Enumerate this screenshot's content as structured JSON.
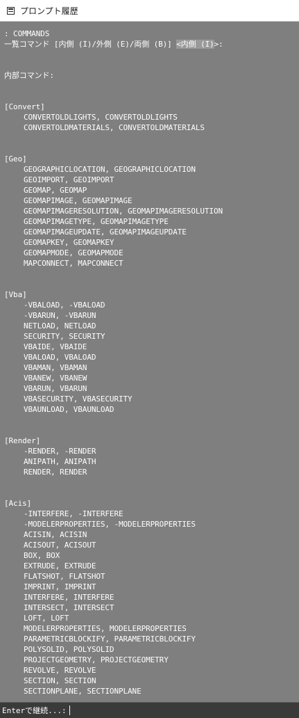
{
  "window": {
    "title": "プロンプト履歴"
  },
  "history": {
    "cmd_line": ": COMMANDS",
    "list_prompt_before": "一覧コマンド [内側 (I)/外側 (E)/両側 (B)] ",
    "list_prompt_default": "<内側 (I)",
    "list_prompt_after": ">:",
    "inner_header": "内部コマンド:",
    "groups": [
      {
        "name": "[Convert]",
        "items": [
          "CONVERTOLDLIGHTS, CONVERTOLDLIGHTS",
          "CONVERTOLDMATERIALS, CONVERTOLDMATERIALS"
        ]
      },
      {
        "name": "[Geo]",
        "items": [
          "GEOGRAPHICLOCATION, GEOGRAPHICLOCATION",
          "GEOIMPORT, GEOIMPORT",
          "GEOMAP, GEOMAP",
          "GEOMAPIMAGE, GEOMAPIMAGE",
          "GEOMAPIMAGERESOLUTION, GEOMAPIMAGERESOLUTION",
          "GEOMAPIMAGETYPE, GEOMAPIMAGETYPE",
          "GEOMAPIMAGEUPDATE, GEOMAPIMAGEUPDATE",
          "GEOMAPKEY, GEOMAPKEY",
          "GEOMAPMODE, GEOMAPMODE",
          "MAPCONNECT, MAPCONNECT"
        ]
      },
      {
        "name": "[Vba]",
        "items": [
          "-VBALOAD, -VBALOAD",
          "-VBARUN, -VBARUN",
          "NETLOAD, NETLOAD",
          "SECURITY, SECURITY",
          "VBAIDE, VBAIDE",
          "VBALOAD, VBALOAD",
          "VBAMAN, VBAMAN",
          "VBANEW, VBANEW",
          "VBARUN, VBARUN",
          "VBASECURITY, VBASECURITY",
          "VBAUNLOAD, VBAUNLOAD"
        ]
      },
      {
        "name": "[Render]",
        "items": [
          "-RENDER, -RENDER",
          "ANIPATH, ANIPATH",
          "RENDER, RENDER"
        ]
      },
      {
        "name": "[Acis]",
        "items": [
          "-INTERFERE, -INTERFERE",
          "-MODELERPROPERTIES, -MODELERPROPERTIES",
          "ACISIN, ACISIN",
          "ACISOUT, ACISOUT",
          "BOX, BOX",
          "EXTRUDE, EXTRUDE",
          "FLATSHOT, FLATSHOT",
          "IMPRINT, IMPRINT",
          "INTERFERE, INTERFERE",
          "INTERSECT, INTERSECT",
          "LOFT, LOFT",
          "MODELERPROPERTIES, MODELERPROPERTIES",
          "PARAMETRICBLOCKIFY, PARAMETRICBLOCKIFY",
          "POLYSOLID, POLYSOLID",
          "PROJECTGEOMETRY, PROJECTGEOMETRY",
          "REVOLVE, REVOLVE",
          "SECTION, SECTION",
          "SECTIONPLANE, SECTIONPLANE"
        ]
      }
    ]
  },
  "prompt": {
    "text": "Enterで継続...:"
  }
}
